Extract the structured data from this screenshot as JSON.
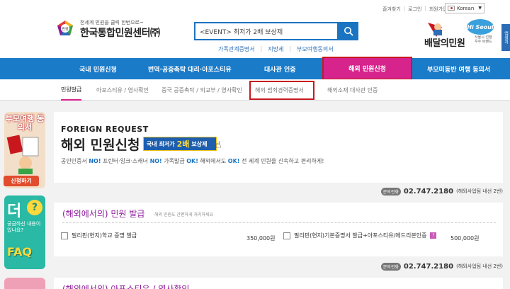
{
  "util": {
    "links": [
      "즐겨찾기",
      "로그인",
      "회원가입"
    ],
    "lang": "Korean"
  },
  "logo": {
    "sub": "전세계 민원을 클릭 한번으로~",
    "title": "한국통합민원센터㈜",
    "mark": "민원"
  },
  "search": {
    "placeholder": "<EVENT> 최저가 2배 보상제"
  },
  "quick_links": [
    "가족관계증명서",
    "지방세",
    "부모여행동의서"
  ],
  "brand": {
    "hi": "Hi Seoul",
    "title": "배달의민원",
    "sub": "서울시 선정 우수 브랜드",
    "side_tab": "앱설치"
  },
  "nav": {
    "items": [
      "국내 민원신청",
      "번역·공증촉탁 대리·아포스티유",
      "대사관 인증",
      "해외 민원신청",
      "부모미동반 여행 동의서"
    ],
    "active_index": 3
  },
  "subnav": {
    "items": [
      "민원발급",
      "아포스티유 / 영사확인",
      "중국 공증촉탁 / 외교부 / 영사확인",
      "해외 범죄경력증명서",
      "해외소재 대사관 인증"
    ],
    "active_index": 0
  },
  "banners": {
    "parent": {
      "title": "부모여행 동의서",
      "cta": "신청하기"
    },
    "faq": {
      "big": "더",
      "q": "?",
      "text": "궁금하신 내용이 있나요?",
      "label": "FAQ"
    }
  },
  "intro": {
    "label": "FOREIGN REQUEST",
    "title": "해외 민원신청",
    "promo_prefix": "국내 최저가",
    "promo_num": "2배",
    "promo_suffix": "보상제",
    "desc_parts": [
      "공인인증서 ",
      "NO!",
      " 프린터·잉크·스캐너 ",
      "NO!",
      " 가족발급 ",
      "OK!",
      " 해외에서도 ",
      "OK!",
      " 전 세계 민원을 신속하고 편리하게!"
    ]
  },
  "phone": {
    "badge": "문의전화",
    "number": "02.747.2180",
    "note": "(해외사업팀 내선 2번)"
  },
  "section1": {
    "title": "(해외에서의) 민원 발급",
    "subtitle": "해외 민원도 간편하게 처리하세요",
    "items": [
      {
        "label": "필리핀(현지)학교 증명 발급",
        "price": "350,000원"
      },
      {
        "label": "필리핀(현지)기본증명서 발급+아포스티유/에드리본인증",
        "price": "500,000원"
      }
    ]
  },
  "section2": {
    "title": "(해외에서의) 아포스티유 / 영사확인"
  },
  "colors": {
    "nav": "#1a7bc9",
    "active": "#d6248c",
    "highlight": "#c8181e",
    "accent": "#8b1a9a"
  }
}
